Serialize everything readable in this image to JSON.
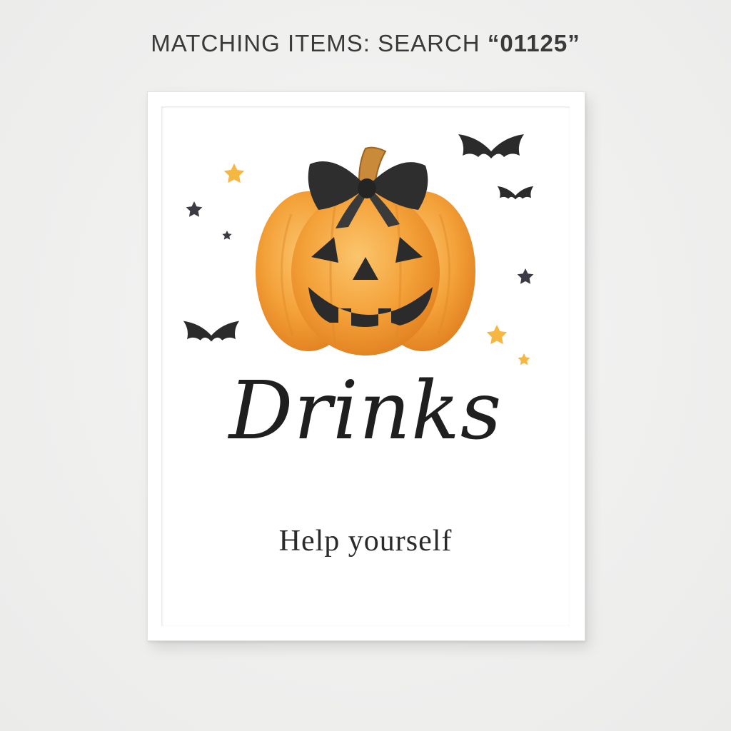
{
  "banner": {
    "prefix": "MATCHING ITEMS: SEARCH ",
    "code": "“01125”"
  },
  "sign": {
    "title": "Drinks",
    "subtitle": "Help yourself"
  },
  "colors": {
    "pumpkin": "#f4a23a",
    "pumpkin_dark": "#e07e1e",
    "bow": "#2e2e2e",
    "star_gold": "#f5b642",
    "star_dark": "#3d3a45"
  },
  "decor": {
    "illustration": "jack-o-lantern-with-bow",
    "accents": [
      "bat-icon",
      "star-icon"
    ]
  }
}
